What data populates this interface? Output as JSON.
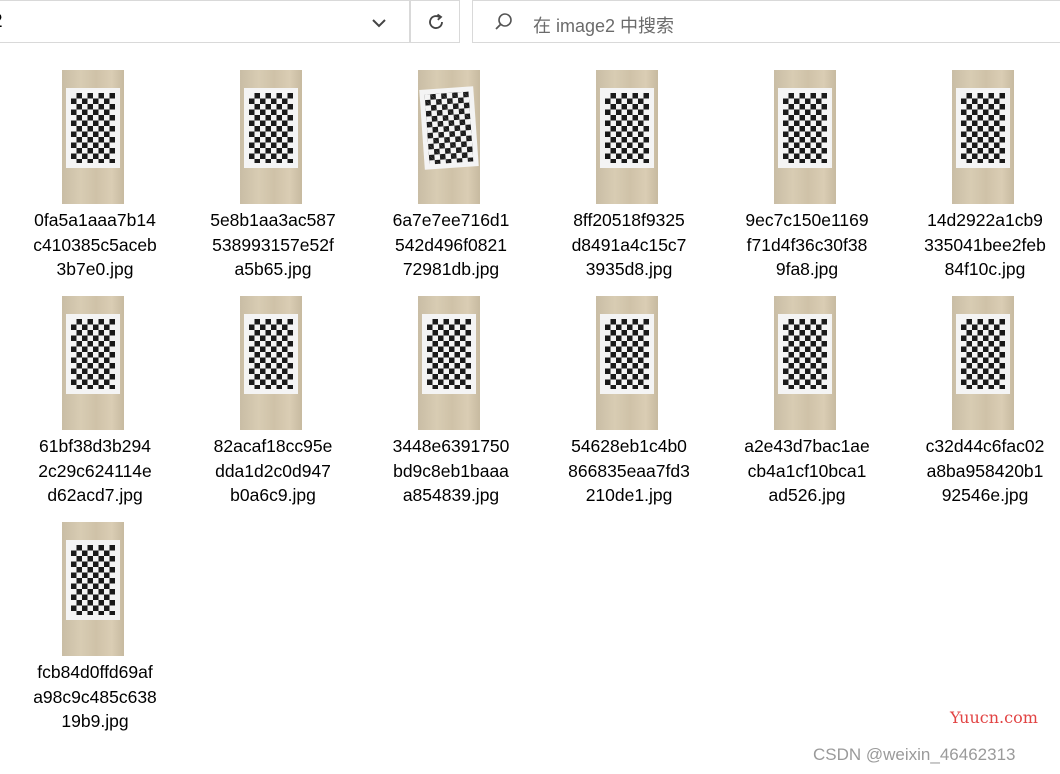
{
  "toolbar": {
    "address_text": "2",
    "dropdown_icon": "chevron-down-icon",
    "refresh_icon": "refresh-icon",
    "search_icon": "search-icon",
    "search_placeholder": "在 image2 中搜索"
  },
  "files": [
    {
      "lines": [
        "0fa5a1aaa7b14",
        "c410385c5aceb",
        "3b7e0.jpg"
      ]
    },
    {
      "lines": [
        "5e8b1aa3ac587",
        "538993157e52f",
        "a5b65.jpg"
      ]
    },
    {
      "lines": [
        "6a7e7ee716d1",
        "542d496f0821",
        "72981db.jpg"
      ]
    },
    {
      "lines": [
        "8ff20518f9325",
        "d8491a4c15c7",
        "3935d8.jpg"
      ]
    },
    {
      "lines": [
        "9ec7c150e1169",
        "f71d4f36c30f38",
        "9fa8.jpg"
      ]
    },
    {
      "lines": [
        "14d2922a1cb9",
        "335041bee2feb",
        "84f10c.jpg"
      ]
    },
    {
      "lines": [
        "61bf38d3b294",
        "2c29c624114e",
        "d62acd7.jpg"
      ]
    },
    {
      "lines": [
        "82acaf18cc95e",
        "dda1d2c0d947",
        "b0a6c9.jpg"
      ]
    },
    {
      "lines": [
        "3448e6391750",
        "bd9c8eb1baaa",
        "a854839.jpg"
      ]
    },
    {
      "lines": [
        "54628eb1c4b0",
        "866835eaa7fd3",
        "210de1.jpg"
      ]
    },
    {
      "lines": [
        "a2e43d7bac1ae",
        "cb4a1cf10bca1",
        "ad526.jpg"
      ]
    },
    {
      "lines": [
        "c32d44c6fac02",
        "a8ba958420b1",
        "92546e.jpg"
      ]
    },
    {
      "lines": [
        "fcb84d0ffd69af",
        "a98c9c485c638",
        "19b9.jpg"
      ]
    }
  ],
  "watermarks": {
    "yuucn": "Yuucn.com",
    "csdn": "CSDN @weixin_46462313"
  },
  "colors": {
    "watermark_red": "#e24444",
    "watermark_gray": "#9a9a9a"
  }
}
